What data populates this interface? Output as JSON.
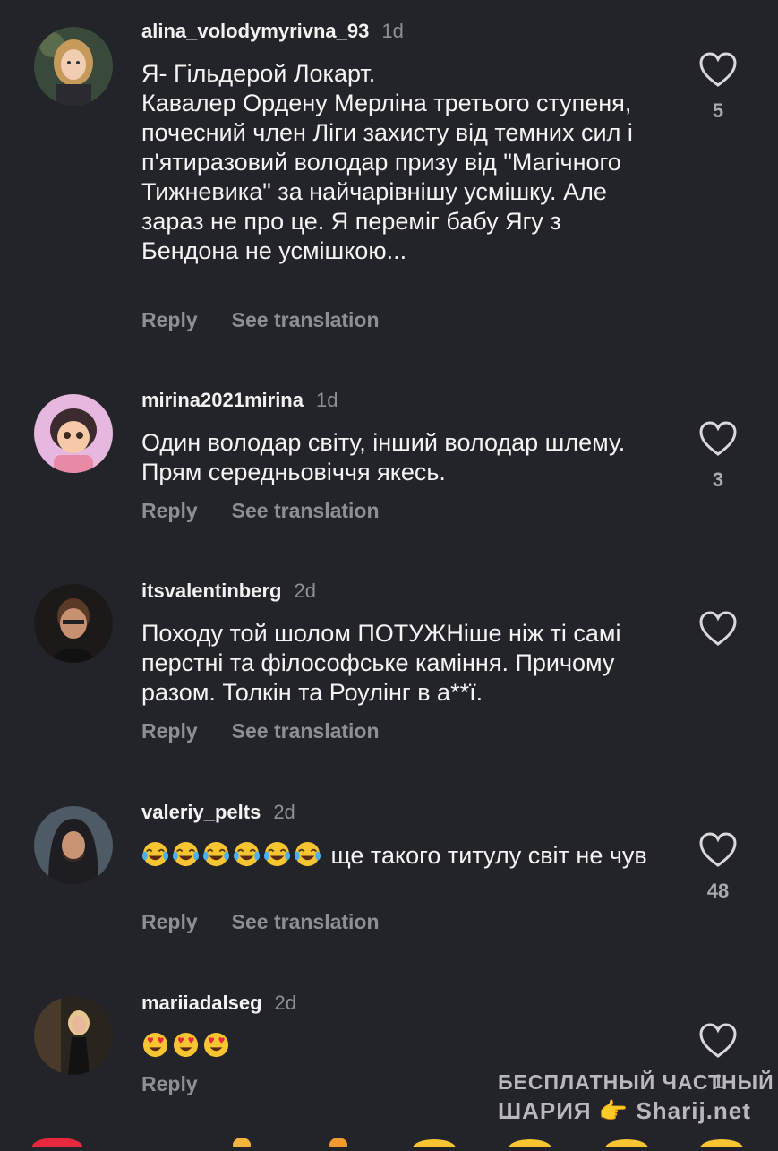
{
  "comments": [
    {
      "username": "alina_volodymyrivna_93",
      "time": "1d",
      "text": "Я- Гільдерой Локарт.\nКавалер Ордену Мерліна третього ступеня, почесний член Ліги захисту від темних сил і п'ятиразовий володар призу від \"Магічного Тижневика\" за найчарівнішу усмішку. Але зараз не про це. Я переміг бабу Ягу з Бендона не усмішкою...",
      "reply_label": "Reply",
      "translate_label": "See translation",
      "likes": "5"
    },
    {
      "username": "mirina2021mirina",
      "time": "1d",
      "text": "Один володар світу, інший володар шлему.  Прям середньовіччя якесь.",
      "reply_label": "Reply",
      "translate_label": "See translation",
      "likes": "3"
    },
    {
      "username": "itsvalentinberg",
      "time": "2d",
      "text": "Походу той шолом ПОТУЖНіше ніж ті самі перстні та філософське каміння. Причому разом. Толкін та Роулінг в а**ї.",
      "reply_label": "Reply",
      "translate_label": "See translation",
      "likes": ""
    },
    {
      "username": "valeriy_pelts",
      "time": "2d",
      "emoji": "😂😂😂😂😂😂",
      "text": " ще такого титулу світ не чув",
      "reply_label": "Reply",
      "translate_label": "See translation",
      "likes": "48"
    },
    {
      "username": "mariiadalseg",
      "time": "2d",
      "emoji": "😍😍😍",
      "text": "",
      "reply_label": "Reply",
      "likes": "1"
    }
  ],
  "watermark": {
    "line1": "БЕСПЛАТНЫЙ ЧАСТНЫЙ",
    "line2": "ШАРИЯ 👉 Sharij.net"
  },
  "icons": {
    "like": "heart-outline-icon",
    "laugh": "face-with-tears-of-joy-icon",
    "love": "heart-eyes-icon"
  },
  "colors": {
    "background": "#232429",
    "text": "#f4f4f4",
    "muted": "#8e8f95"
  }
}
